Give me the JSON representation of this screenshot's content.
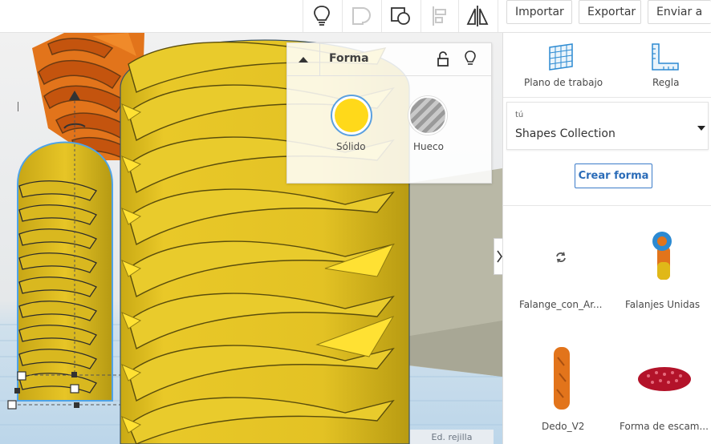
{
  "toolbar": {
    "icons": [
      "lightbulb-icon",
      "union-shape-icon",
      "group-icon",
      "align-icon",
      "mirror-icon"
    ],
    "import_label": "Importar",
    "export_label": "Exportar",
    "send_label": "Enviar a"
  },
  "shape_panel": {
    "title": "Forma",
    "solid_label": "Sólido",
    "hole_label": "Hueco",
    "solid_color": "#ffd91a"
  },
  "right_panel": {
    "workplane_label": "Plano de trabajo",
    "ruler_label": "Regla",
    "library_owner": "tú",
    "library_name": "Shapes Collection",
    "create_shape_label": "Crear forma",
    "shapes": [
      {
        "name": "Falange_con_Ar...",
        "icon": "loading-icon"
      },
      {
        "name": "Falanjes Unidas",
        "icon": "falanjes-thumbnail"
      },
      {
        "name": "Dedo_V2",
        "icon": "dedo-thumbnail"
      },
      {
        "name": "Forma de escam...",
        "icon": "scale-mesh-thumbnail"
      }
    ]
  },
  "viewport": {
    "grid_edit_label": "Ed. rejilla"
  },
  "colors": {
    "yellow": "#e6c224",
    "yellow_dark": "#9c8410",
    "orange": "#e2741b",
    "selection": "#4ea3e8",
    "accent": "#2b6cb8"
  }
}
